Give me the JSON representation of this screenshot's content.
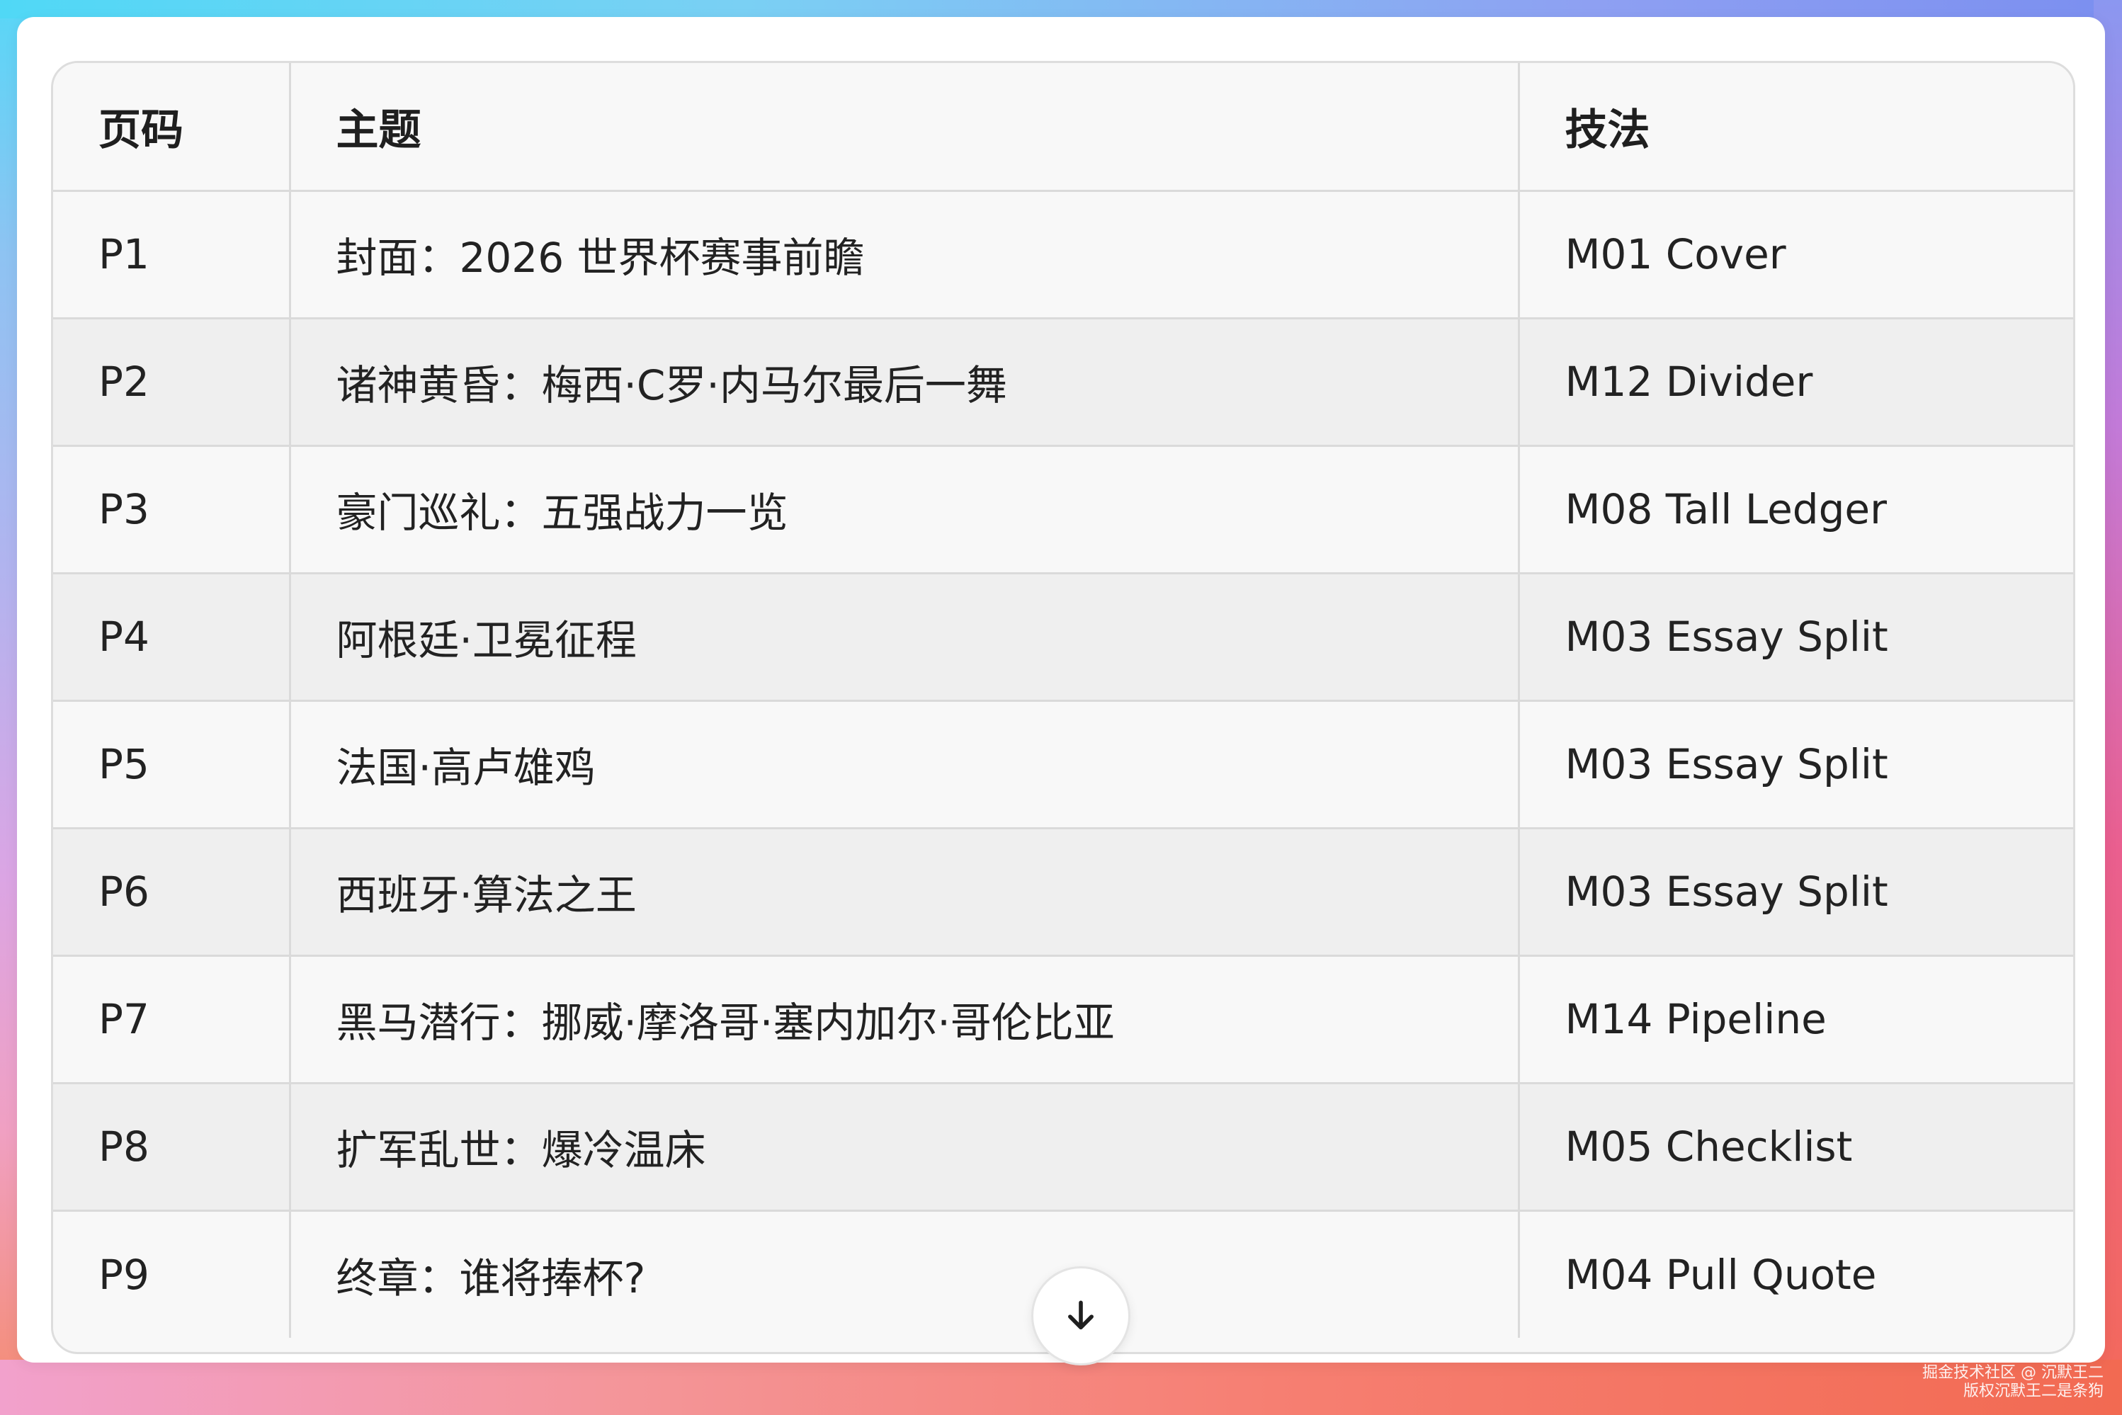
{
  "table": {
    "headers": [
      "页码",
      "主题",
      "技法"
    ],
    "rows": [
      [
        "P1",
        "封面：2026 世界杯赛事前瞻",
        "M01 Cover"
      ],
      [
        "P2",
        "诸神黄昏：梅西·C罗·内马尔最后一舞",
        "M12 Divider"
      ],
      [
        "P3",
        "豪门巡礼：五强战力一览",
        "M08 Tall Ledger"
      ],
      [
        "P4",
        "阿根廷·卫冕征程",
        "M03 Essay Split"
      ],
      [
        "P5",
        "法国·高卢雄鸡",
        "M03 Essay Split"
      ],
      [
        "P6",
        "西班牙·算法之王",
        "M03 Essay Split"
      ],
      [
        "P7",
        "黑马潜行：挪威·摩洛哥·塞内加尔·哥伦比亚",
        "M14 Pipeline"
      ],
      [
        "P8",
        "扩军乱世：爆冷温床",
        "M05 Checklist"
      ],
      [
        "P9",
        "终章：谁将捧杯?",
        "M04 Pull Quote"
      ]
    ]
  },
  "scroll_button": {
    "icon": "arrow-down-icon"
  },
  "watermark": {
    "line1": "掘金技术社区 @ 沉默王二",
    "line2": "版权沉默王二是条狗"
  },
  "colors": {
    "window_bg": "#ffffff",
    "row_alt_bg": "#efefef",
    "row_bg": "#f8f8f8",
    "border": "#dadada",
    "text": "#222222"
  }
}
